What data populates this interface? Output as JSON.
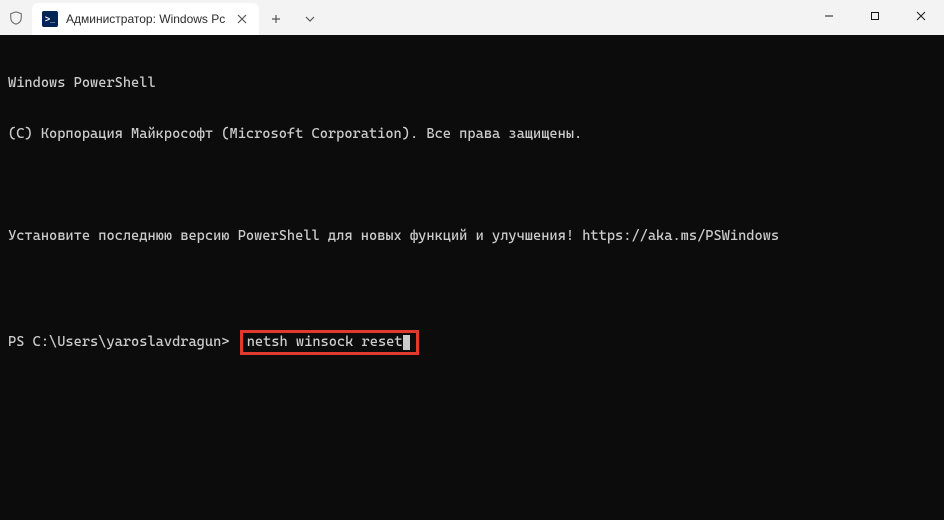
{
  "titlebar": {
    "tab_title": "Администратор: Windows Pc",
    "ps_icon_text": ">_"
  },
  "window_controls": {
    "minimize": "minimize",
    "maximize": "maximize",
    "close": "close"
  },
  "terminal": {
    "line1": "Windows PowerShell",
    "line2": "(C) Корпорация Майкрософт (Microsoft Corporation). Все права защищены.",
    "line3": "Установите последнюю версию PowerShell для новых функций и улучшения! https://aka.ms/PSWindows",
    "prompt": "PS C:\\Users\\yaroslavdragun> ",
    "command": "netsh winsock reset"
  },
  "highlight_color": "#e03a2f"
}
